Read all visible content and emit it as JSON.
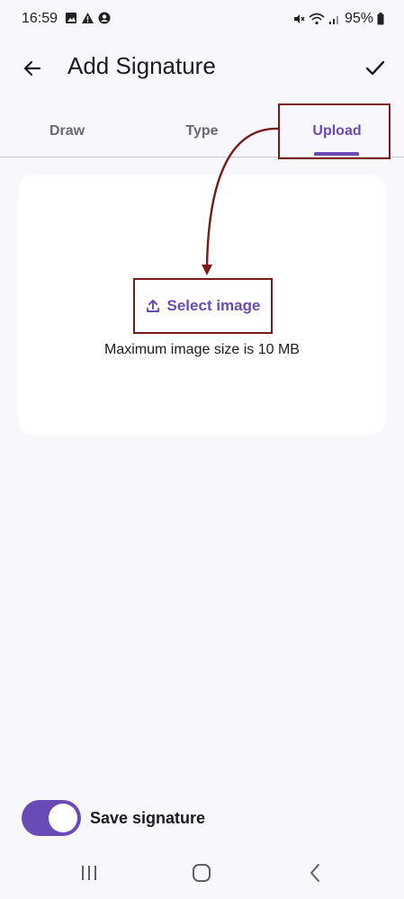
{
  "status_bar": {
    "time": "16:59",
    "battery": "95%",
    "left_icons": [
      "image-icon",
      "warning-icon",
      "account-icon"
    ],
    "right_icons": [
      "mute-icon",
      "wifi-icon",
      "signal-icon",
      "battery-icon"
    ]
  },
  "app_bar": {
    "title": "Add Signature",
    "back_icon": "arrow-back-icon",
    "confirm_icon": "check-icon"
  },
  "tabs": [
    {
      "label": "Draw",
      "selected": false
    },
    {
      "label": "Type",
      "selected": false
    },
    {
      "label": "Upload",
      "selected": true
    }
  ],
  "upload": {
    "select_label": "Select image",
    "select_icon": "upload-icon",
    "max_size_text": "Maximum image size is 10 MB"
  },
  "save": {
    "label": "Save signature",
    "enabled": true
  },
  "colors": {
    "accent": "#6a4bb5",
    "annotation": "#7a1a1a",
    "background": "#f7f7fc",
    "card": "#ffffff"
  }
}
